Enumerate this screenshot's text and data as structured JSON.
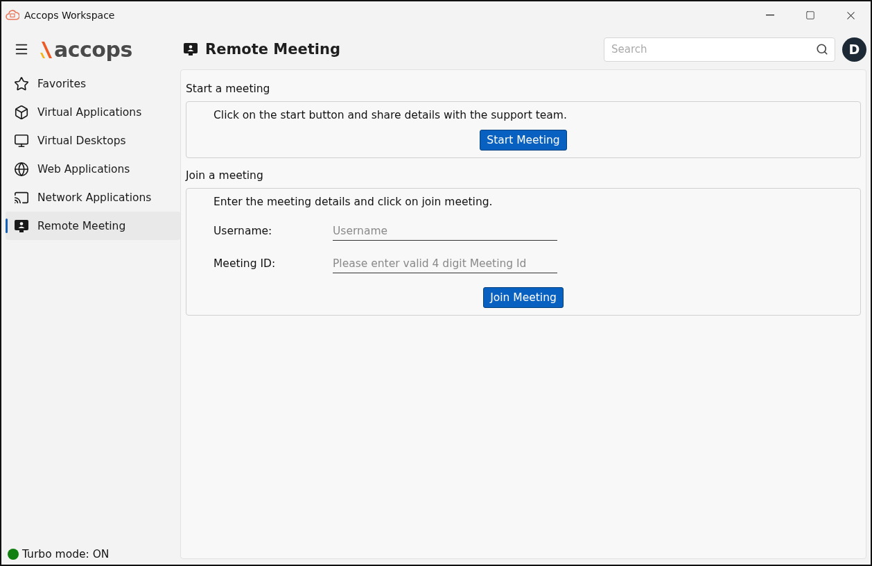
{
  "window": {
    "title": "Accops Workspace"
  },
  "logo": {
    "text": "accops"
  },
  "sidebar": {
    "items": [
      {
        "label": "Favorites",
        "selected": false
      },
      {
        "label": "Virtual Applications",
        "selected": false
      },
      {
        "label": "Virtual Desktops",
        "selected": false
      },
      {
        "label": "Web Applications",
        "selected": false
      },
      {
        "label": "Network Applications",
        "selected": false
      },
      {
        "label": "Remote Meeting",
        "selected": true
      }
    ]
  },
  "header": {
    "title": "Remote Meeting",
    "search": {
      "placeholder": "Search"
    },
    "avatar": "D"
  },
  "start_section": {
    "heading": "Start a meeting",
    "text": "Click on the start button and share details with the support team.",
    "button": "Start Meeting"
  },
  "join_section": {
    "heading": "Join a meeting",
    "text": "Enter the meeting details and click on join meeting.",
    "fields": [
      {
        "label": "Username:",
        "placeholder": "Username"
      },
      {
        "label": "Meeting ID:",
        "placeholder": "Please enter valid 4 digit Meeting Id"
      }
    ],
    "button": "Join Meeting"
  },
  "status": {
    "label": "Turbo mode: ON",
    "on": true
  }
}
